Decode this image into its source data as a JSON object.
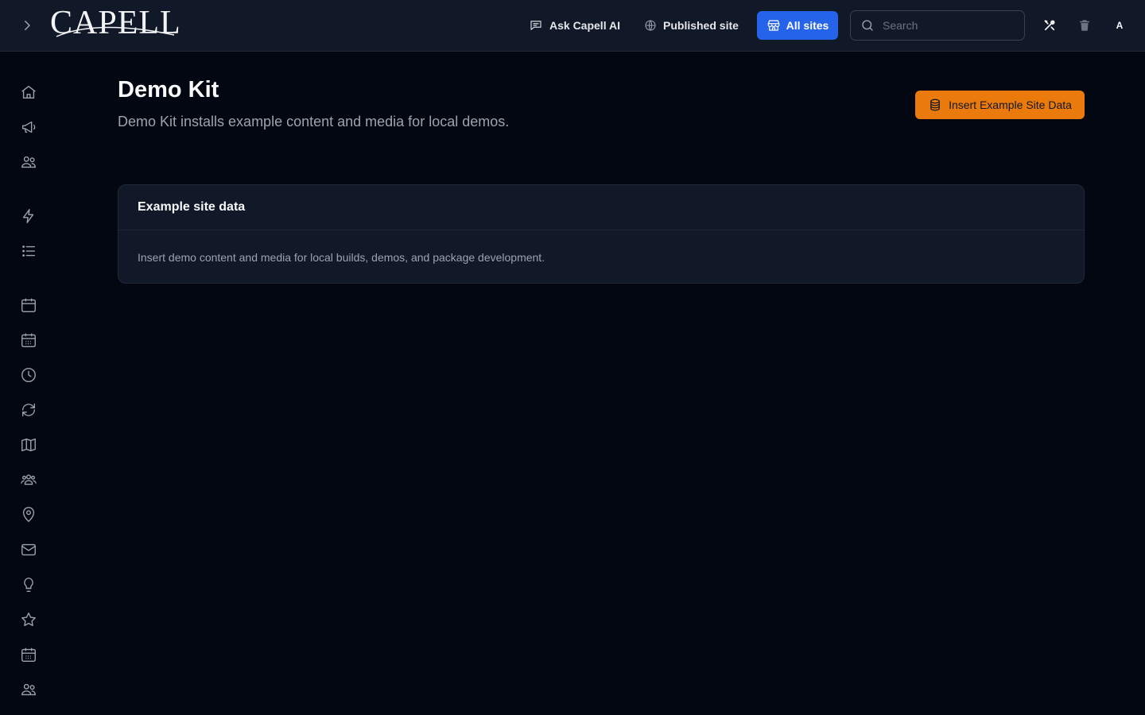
{
  "app": {
    "logo_text": "CAPELL"
  },
  "topbar": {
    "ask_ai_label": "Ask Capell AI",
    "published_site_label": "Published site",
    "all_sites_label": "All sites",
    "search_placeholder": "Search",
    "avatar_initial": "A",
    "accent_color": "#2563eb"
  },
  "sidebar": {
    "items": [
      {
        "icon": "home-icon"
      },
      {
        "icon": "megaphone-icon"
      },
      {
        "icon": "users-icon"
      },
      {
        "icon": "bolt-icon"
      },
      {
        "icon": "list-icon"
      },
      {
        "icon": "calendar-icon"
      },
      {
        "icon": "calendar-days-icon"
      },
      {
        "icon": "clock-icon"
      },
      {
        "icon": "refresh-icon"
      },
      {
        "icon": "map-icon"
      },
      {
        "icon": "user-group-icon"
      },
      {
        "icon": "map-pin-icon"
      },
      {
        "icon": "mail-icon"
      },
      {
        "icon": "lightbulb-icon"
      },
      {
        "icon": "star-icon"
      },
      {
        "icon": "calendar-days-icon"
      },
      {
        "icon": "users-icon"
      }
    ]
  },
  "main": {
    "title": "Demo Kit",
    "subtitle": "Demo Kit installs example content and media for local demos.",
    "insert_button_label": "Insert Example Site Data",
    "insert_button_color": "#ea7a0c",
    "card": {
      "heading": "Example site data",
      "description": "Insert demo content and media for local builds, demos, and package development."
    }
  }
}
